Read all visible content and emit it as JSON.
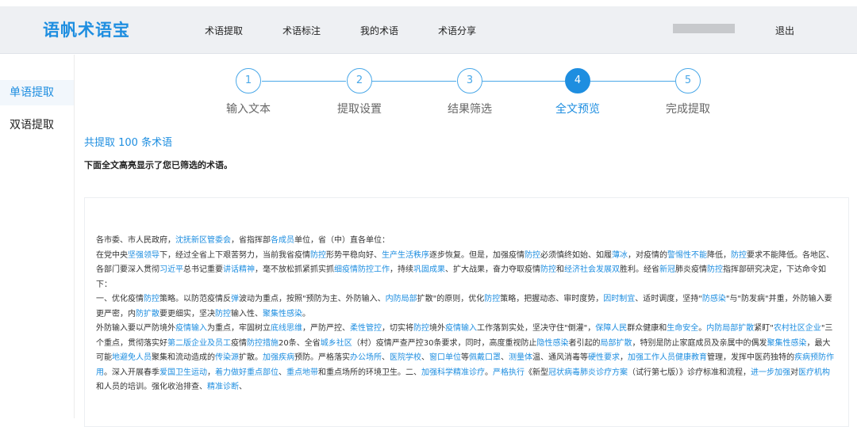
{
  "header": {
    "logo": "语帆术语宝",
    "nav": [
      "术语提取",
      "术语标注",
      "我的术语",
      "术语分享"
    ],
    "logout": "退出"
  },
  "sidebar": {
    "items": [
      {
        "label": "单语提取",
        "active": true
      },
      {
        "label": "双语提取",
        "active": false
      }
    ]
  },
  "steps": [
    {
      "num": "1",
      "label": "输入文本",
      "active": false
    },
    {
      "num": "2",
      "label": "提取设置",
      "active": false
    },
    {
      "num": "3",
      "label": "结果筛选",
      "active": false
    },
    {
      "num": "4",
      "label": "全文预览",
      "active": true
    },
    {
      "num": "5",
      "label": "完成提取",
      "active": false
    }
  ],
  "summary": {
    "count": "共提取 100 条术语",
    "hint": "下面全文高亮显示了您已筛选的术语。"
  },
  "colors": {
    "accent": "#1e8ee0"
  },
  "document": {
    "paragraphs": [
      [
        {
          "t": "各市委、市人民政府，"
        },
        {
          "t": "沈抚新区管委会",
          "hl": true
        },
        {
          "t": "，省指挥部"
        },
        {
          "t": "各成员",
          "hl": true
        },
        {
          "t": "单位，省（中）直各单位："
        }
      ],
      [
        {
          "t": "在党中央"
        },
        {
          "t": "坚强领导",
          "hl": true
        },
        {
          "t": "下，经过全省上下艰苦努力，当前我省疫情"
        },
        {
          "t": "防控",
          "hl": true
        },
        {
          "t": "形势平稳向好、"
        },
        {
          "t": "生产生活秩序",
          "hl": true
        },
        {
          "t": "逐步恢复。但是，加强疫情"
        },
        {
          "t": "防控",
          "hl": true
        },
        {
          "t": "必须慎终如始、如履"
        },
        {
          "t": "薄冰",
          "hl": true
        },
        {
          "t": "，对疫情的"
        },
        {
          "t": "警惕性不能",
          "hl": true
        },
        {
          "t": "降低，"
        },
        {
          "t": "防控",
          "hl": true
        },
        {
          "t": "要求不能降低。各地区、各部门要深入贯彻"
        },
        {
          "t": "习近平",
          "hl": true
        },
        {
          "t": "总书记重要"
        },
        {
          "t": "讲话精神",
          "hl": true
        },
        {
          "t": "，毫不放松抓紧抓实抓"
        },
        {
          "t": "细疫情防控工作",
          "hl": true
        },
        {
          "t": "，持续"
        },
        {
          "t": "巩固成果",
          "hl": true
        },
        {
          "t": "、扩大战果，奋力夺取疫情"
        },
        {
          "t": "防控",
          "hl": true
        },
        {
          "t": "和"
        },
        {
          "t": "经济社会发展双",
          "hl": true
        },
        {
          "t": "胜利。经省"
        },
        {
          "t": "新冠",
          "hl": true
        },
        {
          "t": "肺炎疫情"
        },
        {
          "t": "防控",
          "hl": true
        },
        {
          "t": "指挥部研究决定，下达命令如下："
        }
      ],
      [
        {
          "t": "一、优化疫情"
        },
        {
          "t": "防控",
          "hl": true
        },
        {
          "t": "策略。以防范疫情反"
        },
        {
          "t": "弹",
          "hl": true
        },
        {
          "t": "波动为重点，按照\"预防为主、外防输入、"
        },
        {
          "t": "内防局部",
          "hl": true
        },
        {
          "t": "扩散\"的原则，优化"
        },
        {
          "t": "防控",
          "hl": true
        },
        {
          "t": "策略，把握动态、审时度势，"
        },
        {
          "t": "因时制宜",
          "hl": true
        },
        {
          "t": "、适时调度，坚持\""
        },
        {
          "t": "防感染",
          "hl": true
        },
        {
          "t": "\"与\"防发病\"并重，外防输入要更严密，内"
        },
        {
          "t": "防扩散",
          "hl": true
        },
        {
          "t": "要更细实，坚决"
        },
        {
          "t": "防控",
          "hl": true
        },
        {
          "t": "输入性、"
        },
        {
          "t": "聚集性感染",
          "hl": true
        },
        {
          "t": "。"
        }
      ],
      [
        {
          "t": "外防输入要以严防境外"
        },
        {
          "t": "疫情输入",
          "hl": true
        },
        {
          "t": "为重点，牢固树立"
        },
        {
          "t": "底线思维",
          "hl": true
        },
        {
          "t": "，严防严控、"
        },
        {
          "t": "柔性管控",
          "hl": true
        },
        {
          "t": "，切实将"
        },
        {
          "t": "防控",
          "hl": true
        },
        {
          "t": "境外"
        },
        {
          "t": "疫情输入",
          "hl": true
        },
        {
          "t": "工作落到实处，坚决守住\"倒灌\"，"
        },
        {
          "t": "保障人民",
          "hl": true
        },
        {
          "t": "群众健康和"
        },
        {
          "t": "生命安全",
          "hl": true
        },
        {
          "t": "。"
        },
        {
          "t": "内防局部扩散",
          "hl": true
        },
        {
          "t": "紧盯\""
        },
        {
          "t": "农村社区企业",
          "hl": true
        },
        {
          "t": "\"三个重点，贯彻落实好"
        },
        {
          "t": "第二版企业及员工",
          "hl": true
        },
        {
          "t": "疫情"
        },
        {
          "t": "防控措施",
          "hl": true
        },
        {
          "t": "20条、全省"
        },
        {
          "t": "城乡社区",
          "hl": true
        },
        {
          "t": "（村）疫情严查严控30条要求，同时，高度重视防止"
        },
        {
          "t": "隐性感染",
          "hl": true
        },
        {
          "t": "者引起的"
        },
        {
          "t": "局部扩散",
          "hl": true
        },
        {
          "t": "，特别是防止家庭成员及亲属中的偶发"
        },
        {
          "t": "聚集性感染",
          "hl": true
        },
        {
          "t": "，最大可能"
        },
        {
          "t": "地避免人员",
          "hl": true
        },
        {
          "t": "聚集和流动造成的"
        },
        {
          "t": "传染源",
          "hl": true
        },
        {
          "t": "扩散。"
        },
        {
          "t": "加强疾病",
          "hl": true
        },
        {
          "t": "预防。严格落实"
        },
        {
          "t": "办公场所",
          "hl": true
        },
        {
          "t": "、"
        },
        {
          "t": "医院学校",
          "hl": true
        },
        {
          "t": "、"
        },
        {
          "t": "窗口单位",
          "hl": true
        },
        {
          "t": "等"
        },
        {
          "t": "佩戴口罩",
          "hl": true
        },
        {
          "t": "、"
        },
        {
          "t": "测量体",
          "hl": true
        },
        {
          "t": "温、通风消毒等"
        },
        {
          "t": "硬性要求",
          "hl": true
        },
        {
          "t": "，"
        },
        {
          "t": "加强工作人员健康教育",
          "hl": true
        },
        {
          "t": "管理，发挥中医药独特的"
        },
        {
          "t": "疾病预防作用",
          "hl": true
        },
        {
          "t": "。深入开展春季"
        },
        {
          "t": "爱国卫生运动",
          "hl": true
        },
        {
          "t": "，"
        },
        {
          "t": "着力做好重点部位",
          "hl": true
        },
        {
          "t": "、"
        },
        {
          "t": "重点地带",
          "hl": true
        },
        {
          "t": "和重点场所的环境卫生。二、"
        },
        {
          "t": "加强科学精准诊疗",
          "hl": true
        },
        {
          "t": "。"
        },
        {
          "t": "严格执行",
          "hl": true
        },
        {
          "t": "《新型"
        },
        {
          "t": "冠状病毒肺炎诊疗方案",
          "hl": true
        },
        {
          "t": "（试行第七版）》诊疗标准和流程，"
        },
        {
          "t": "进一步加强",
          "hl": true
        },
        {
          "t": "对"
        },
        {
          "t": "医疗机构",
          "hl": true
        },
        {
          "t": "和人员的培训。强化收治排查、"
        },
        {
          "t": "精准诊断",
          "hl": true
        },
        {
          "t": "、"
        }
      ]
    ]
  }
}
